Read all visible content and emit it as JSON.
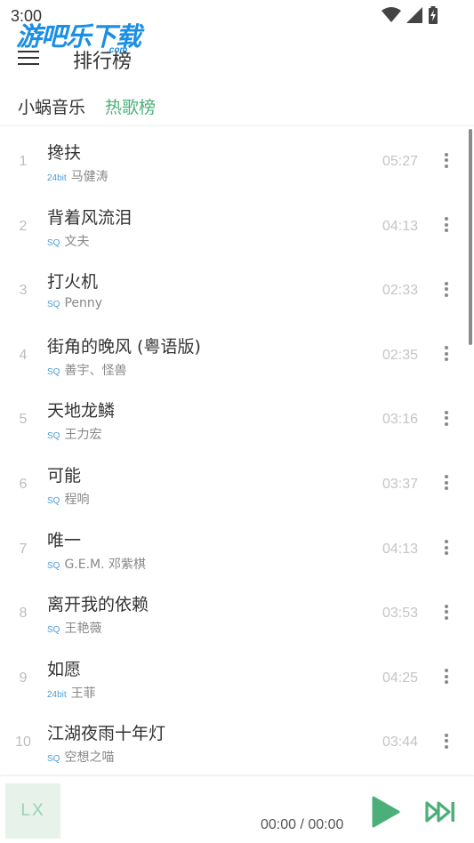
{
  "status_bar": {
    "time": "3:00"
  },
  "watermark": {
    "text": "游吧乐下载",
    "sub": ".com"
  },
  "header": {
    "title": "排行榜"
  },
  "tabs": {
    "source": "小蜗音乐",
    "board": "热歌榜"
  },
  "songs": [
    {
      "num": "1",
      "title": "搀扶",
      "quality": "24bit",
      "artist": "马健涛",
      "duration": "05:27"
    },
    {
      "num": "2",
      "title": "背着风流泪",
      "quality": "SQ",
      "artist": "文夫",
      "duration": "04:13"
    },
    {
      "num": "3",
      "title": "打火机",
      "quality": "SQ",
      "artist": "Penny",
      "duration": "02:33"
    },
    {
      "num": "4",
      "title": "街角的晚风 (粤语版)",
      "quality": "SQ",
      "artist": "善宇、怪兽",
      "duration": "02:35"
    },
    {
      "num": "5",
      "title": "天地龙鳞",
      "quality": "SQ",
      "artist": "王力宏",
      "duration": "03:16"
    },
    {
      "num": "6",
      "title": "可能",
      "quality": "SQ",
      "artist": "程响",
      "duration": "03:37"
    },
    {
      "num": "7",
      "title": "唯一",
      "quality": "SQ",
      "artist": "G.E.M. 邓紫棋",
      "duration": "04:13"
    },
    {
      "num": "8",
      "title": "离开我的依赖",
      "quality": "SQ",
      "artist": "王艳薇",
      "duration": "03:53"
    },
    {
      "num": "9",
      "title": "如愿",
      "quality": "24bit",
      "artist": "王菲",
      "duration": "04:25"
    },
    {
      "num": "10",
      "title": "江湖夜雨十年灯",
      "quality": "SQ",
      "artist": "空想之喵",
      "duration": "03:44"
    }
  ],
  "player": {
    "cover_text": "LX",
    "time": "00:00 / 00:00"
  },
  "colors": {
    "accent": "#4caf7a",
    "quality": "#4a9fd8",
    "watermark": "#1a8fe3"
  },
  "icons": {
    "menu": "hamburger-icon",
    "more": "more-vertical-icon",
    "play": "play-icon",
    "next": "skip-next-icon",
    "wifi": "wifi-icon",
    "signal": "signal-icon",
    "battery": "battery-icon"
  }
}
